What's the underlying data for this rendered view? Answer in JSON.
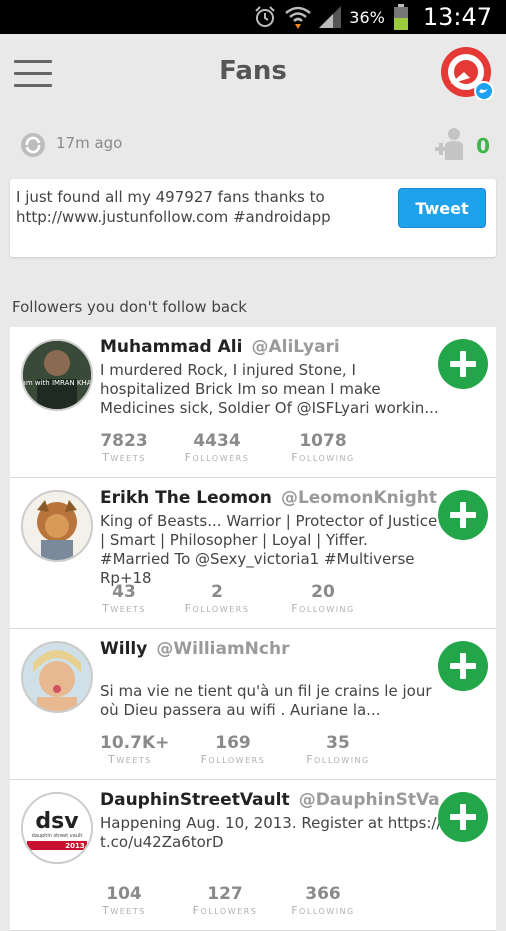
{
  "status_bar": {
    "battery": "36%",
    "time": "13:47"
  },
  "app_bar": {
    "title": "Fans"
  },
  "info": {
    "last_updated": "17m ago",
    "new_fans": "0"
  },
  "compose": {
    "text": "I just found all my 497927 fans thanks to http://www.justunfollow.com #androidapp",
    "button": "Tweet"
  },
  "section_label": "Followers you don't follow back",
  "users": [
    {
      "name": "Muhammad Ali",
      "handle": "@AliLyari",
      "bio": "I murdered Rock, I injured Stone, I hospitalized Brick Im so mean I make Medicines sick, Soldier Of @ISFLyari workin...",
      "tweets": "7823",
      "followers": "4434",
      "following": "1078",
      "avatar_text": "I am with IMRAN KHAN"
    },
    {
      "name": "Erikh The Leomon",
      "handle": "@LeomonKnight",
      "bio": "King of Beasts... Warrior | Protector of Justice | Smart | Philosopher | Loyal | Yiffer. #Married To @Sexy_victoria1 #Multiverse Rp+18",
      "tweets": "43",
      "followers": "2",
      "following": "20"
    },
    {
      "name": "Willy",
      "handle": "@WilliamNchr",
      "bio": "\nSi ma vie ne tient qu'à un fil je crains le jour où Dieu passera au wifi .   Auriane la...",
      "tweets": "10.7K+",
      "followers": "169",
      "following": "35"
    },
    {
      "name": "DauphinStreetVault",
      "handle": "@DauphinStVault",
      "bio": "Happening Aug. 10, 2013. Register at https://t.co/u42Za6torD",
      "tweets": "104",
      "followers": "127",
      "following": "366",
      "avatar_text": "dsv",
      "avatar_sub": "dauphin street vault",
      "avatar_year": "2013"
    }
  ],
  "stat_labels": {
    "tweets": "Tweets",
    "followers": "Followers",
    "following": "Following"
  },
  "colors": {
    "accent_green": "#23a64a",
    "tweet_blue": "#1fa1ec",
    "brand_red": "#e53935",
    "twitter_blue": "#1da1f2"
  }
}
